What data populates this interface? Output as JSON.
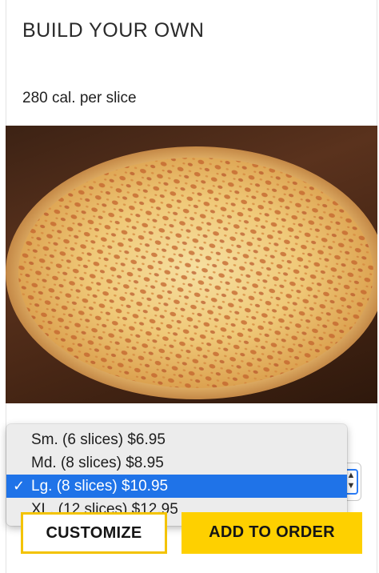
{
  "product": {
    "title": "BUILD YOUR OWN",
    "calories": "280 cal. per slice",
    "image": "cheese-pizza-photo"
  },
  "size_select": {
    "options": [
      {
        "label": "Sm. (6 slices)  $6.95",
        "selected": false
      },
      {
        "label": "Md. (8 slices)  $8.95",
        "selected": false
      },
      {
        "label": "Lg. (8 slices)  $10.95",
        "selected": true
      },
      {
        "label": "XL. (12 slices)  $12.95",
        "selected": false
      }
    ],
    "checkmark": "✓"
  },
  "actions": {
    "customize_label": "CUSTOMIZE",
    "add_label": "ADD TO ORDER"
  },
  "colors": {
    "accent_yellow": "#fed000",
    "select_highlight": "#1f73e8",
    "focus_ring": "#2a7cf6"
  }
}
